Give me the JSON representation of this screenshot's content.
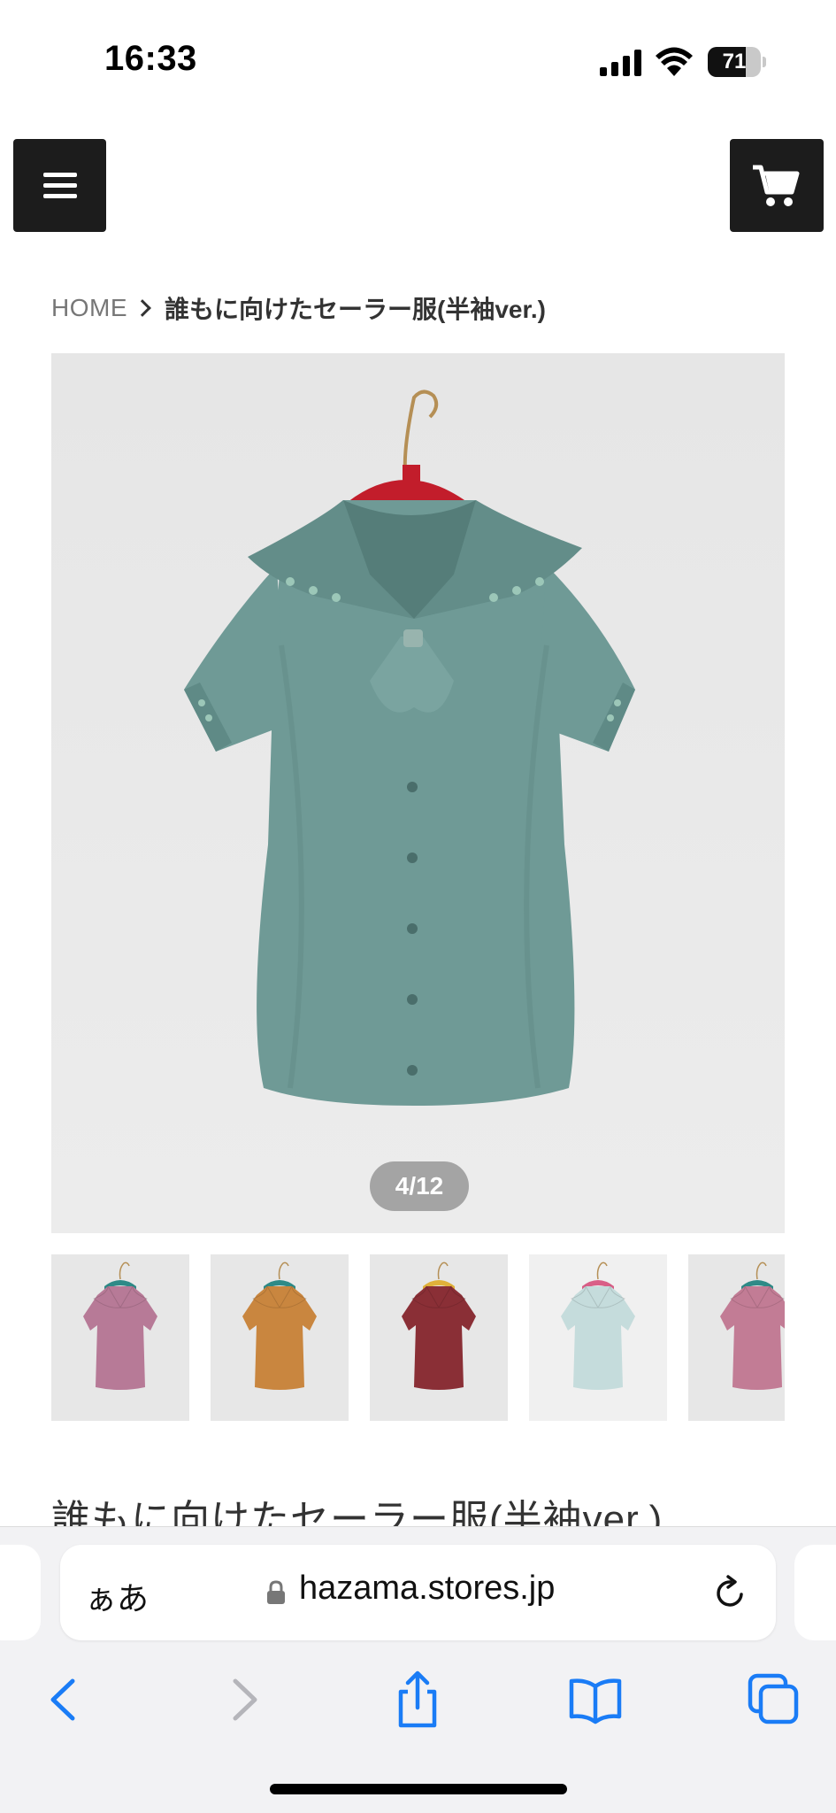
{
  "status_bar": {
    "time": "16:33",
    "battery_level": "71",
    "battery_fraction": 0.71,
    "icons": [
      "cellular-signal-icon",
      "wifi-icon",
      "battery-icon"
    ]
  },
  "header": {
    "menu_icon": "hamburger-menu-icon",
    "cart_icon": "shopping-cart-icon"
  },
  "breadcrumb": {
    "home": "HOME",
    "current": "誰もに向けたセーラー服(半袖ver.)"
  },
  "gallery": {
    "pager_text": "4/12",
    "current_index": 4,
    "total": 12,
    "main_color": "#6f9a96",
    "thumbnails": [
      {
        "color": "#b77a97",
        "hanger": "#2e8a87"
      },
      {
        "color": "#c9863f",
        "hanger": "#2e8a87"
      },
      {
        "color": "#8a2f36",
        "hanger": "#e0b13a"
      },
      {
        "color": "#c5dcdc",
        "hanger": "#d95f87"
      },
      {
        "color": "#c27c95",
        "hanger": "#2e8a87"
      }
    ]
  },
  "product": {
    "title": "誰もに向けたセーラー服(半袖ver.)"
  },
  "browser": {
    "aa_label": "ぁあ",
    "url": "hazama.stores.jp",
    "accent": "#1a7cf6",
    "toolbar_icons": [
      "back-icon",
      "forward-icon",
      "share-icon",
      "bookmarks-icon",
      "tabs-icon"
    ]
  }
}
